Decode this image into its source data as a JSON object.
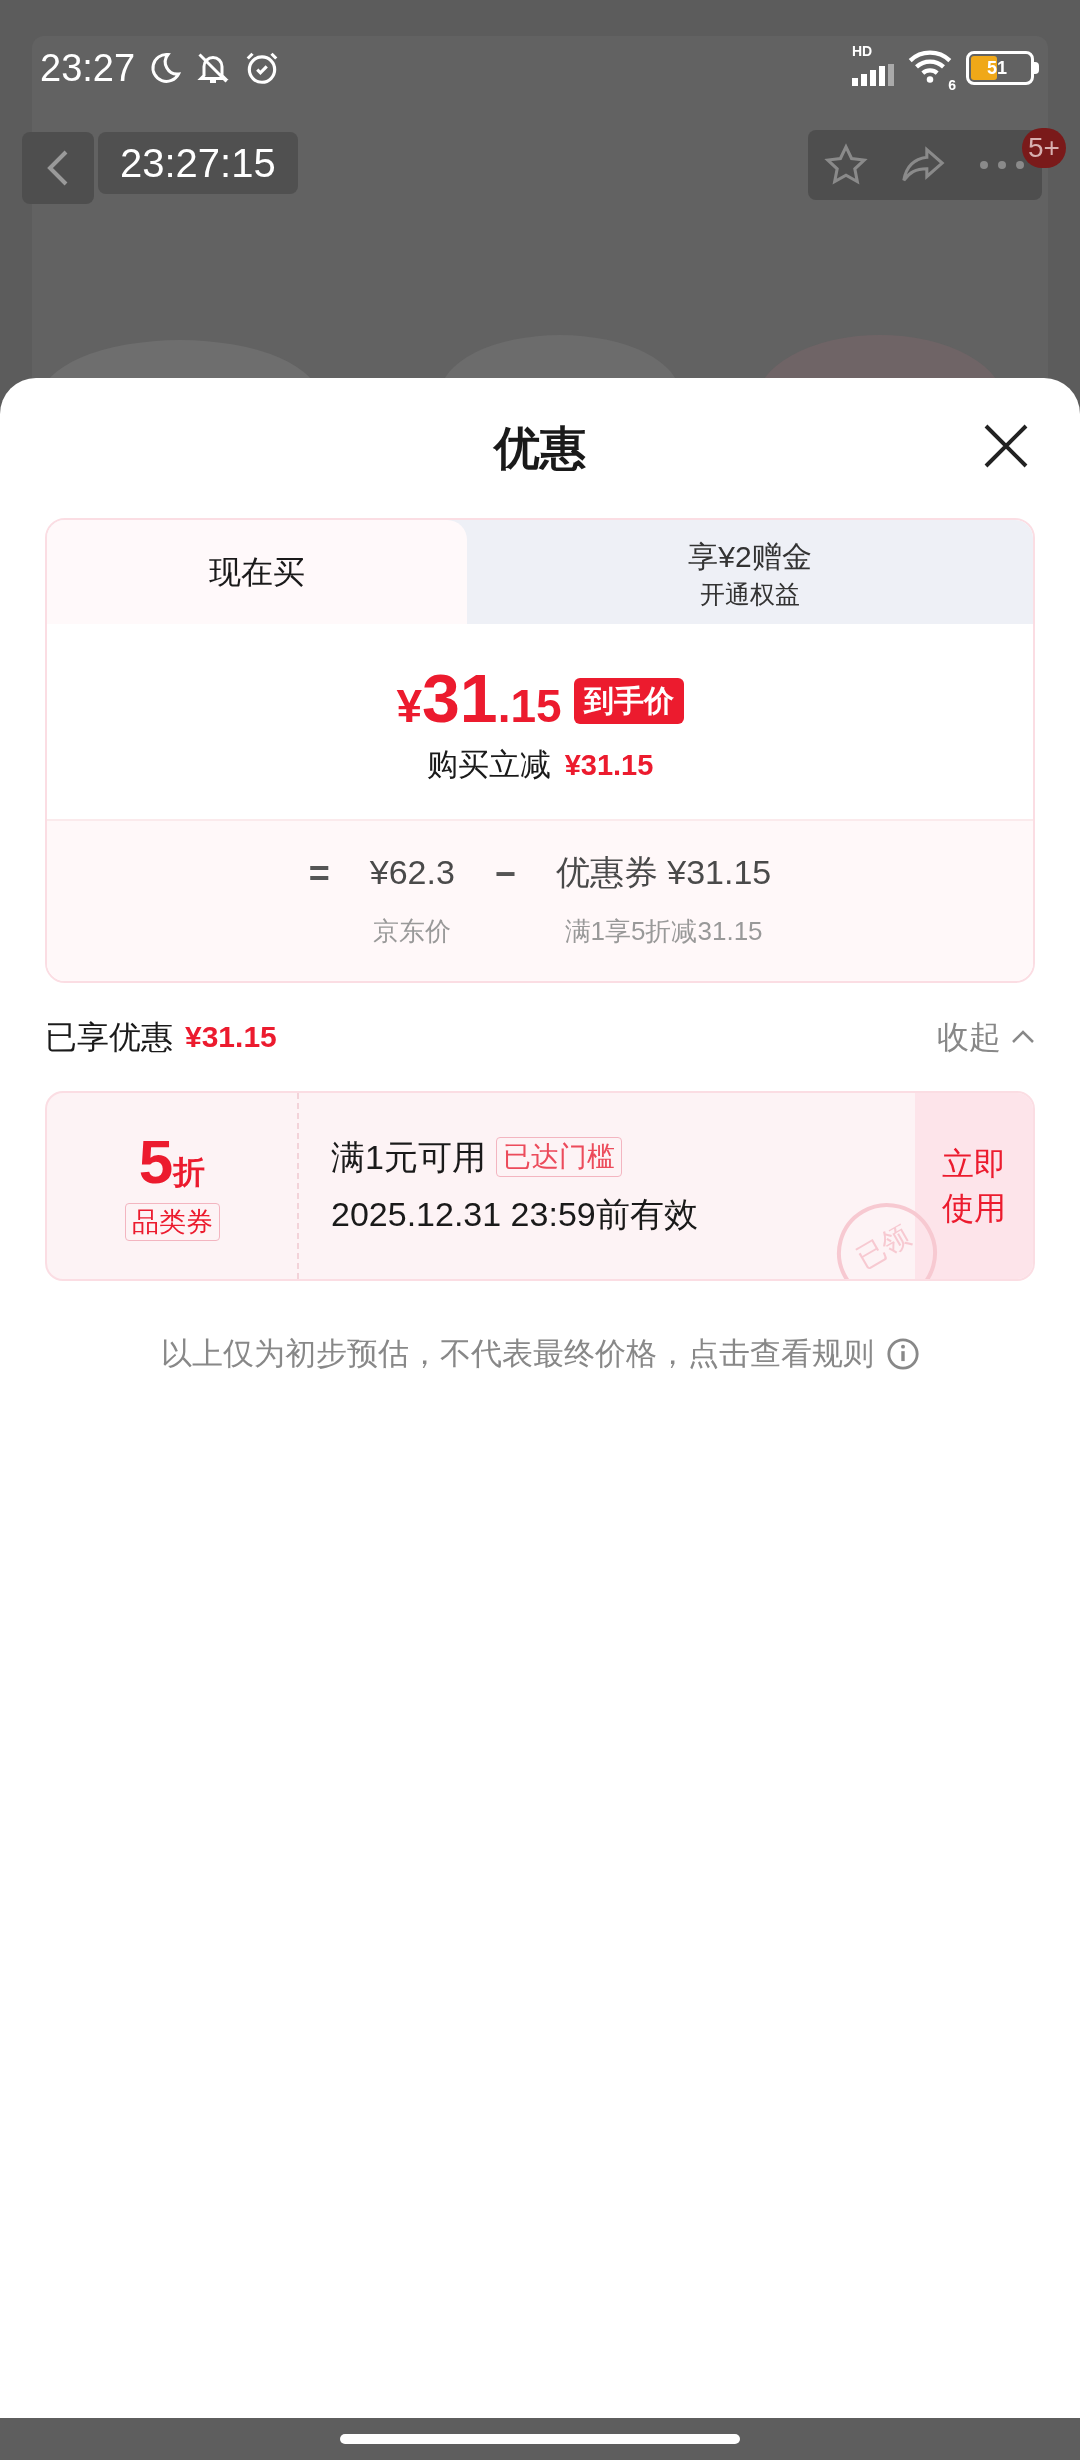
{
  "status_bar": {
    "time": "23:27",
    "network": "HD",
    "wifi_band": "6",
    "battery": "51"
  },
  "header": {
    "timer": "23:27:15",
    "badge": "5+"
  },
  "sheet": {
    "title": "优惠",
    "tabs": [
      {
        "label": "现在买",
        "selected": true
      },
      {
        "label": "享¥2赠金",
        "sub": "开通权益",
        "selected": false
      }
    ],
    "price": {
      "symbol": "¥",
      "integer": "31",
      "decimal": ".15",
      "tag": "到手价"
    },
    "saving": {
      "label": "购买立减",
      "amount": "¥31.15"
    },
    "formula": {
      "equals": "=",
      "base": "¥62.3",
      "base_label": "京东价",
      "minus": "−",
      "coupon": "优惠券 ¥31.15",
      "coupon_label": "满1享5折减31.15"
    },
    "enjoyed": {
      "label": "已享优惠",
      "amount": "¥31.15",
      "toggle": "收起",
      "expanded": true
    },
    "coupons": [
      {
        "value": "5",
        "unit": "折",
        "type": "品类券",
        "condition": "满1元可用",
        "tag": "已达门槛",
        "validity": "2025.12.31 23:59前有效",
        "stamp": "已领",
        "action": "立即使用"
      }
    ],
    "note": "以上仅为初步预估，不代表最终价格，点击查看规则"
  }
}
